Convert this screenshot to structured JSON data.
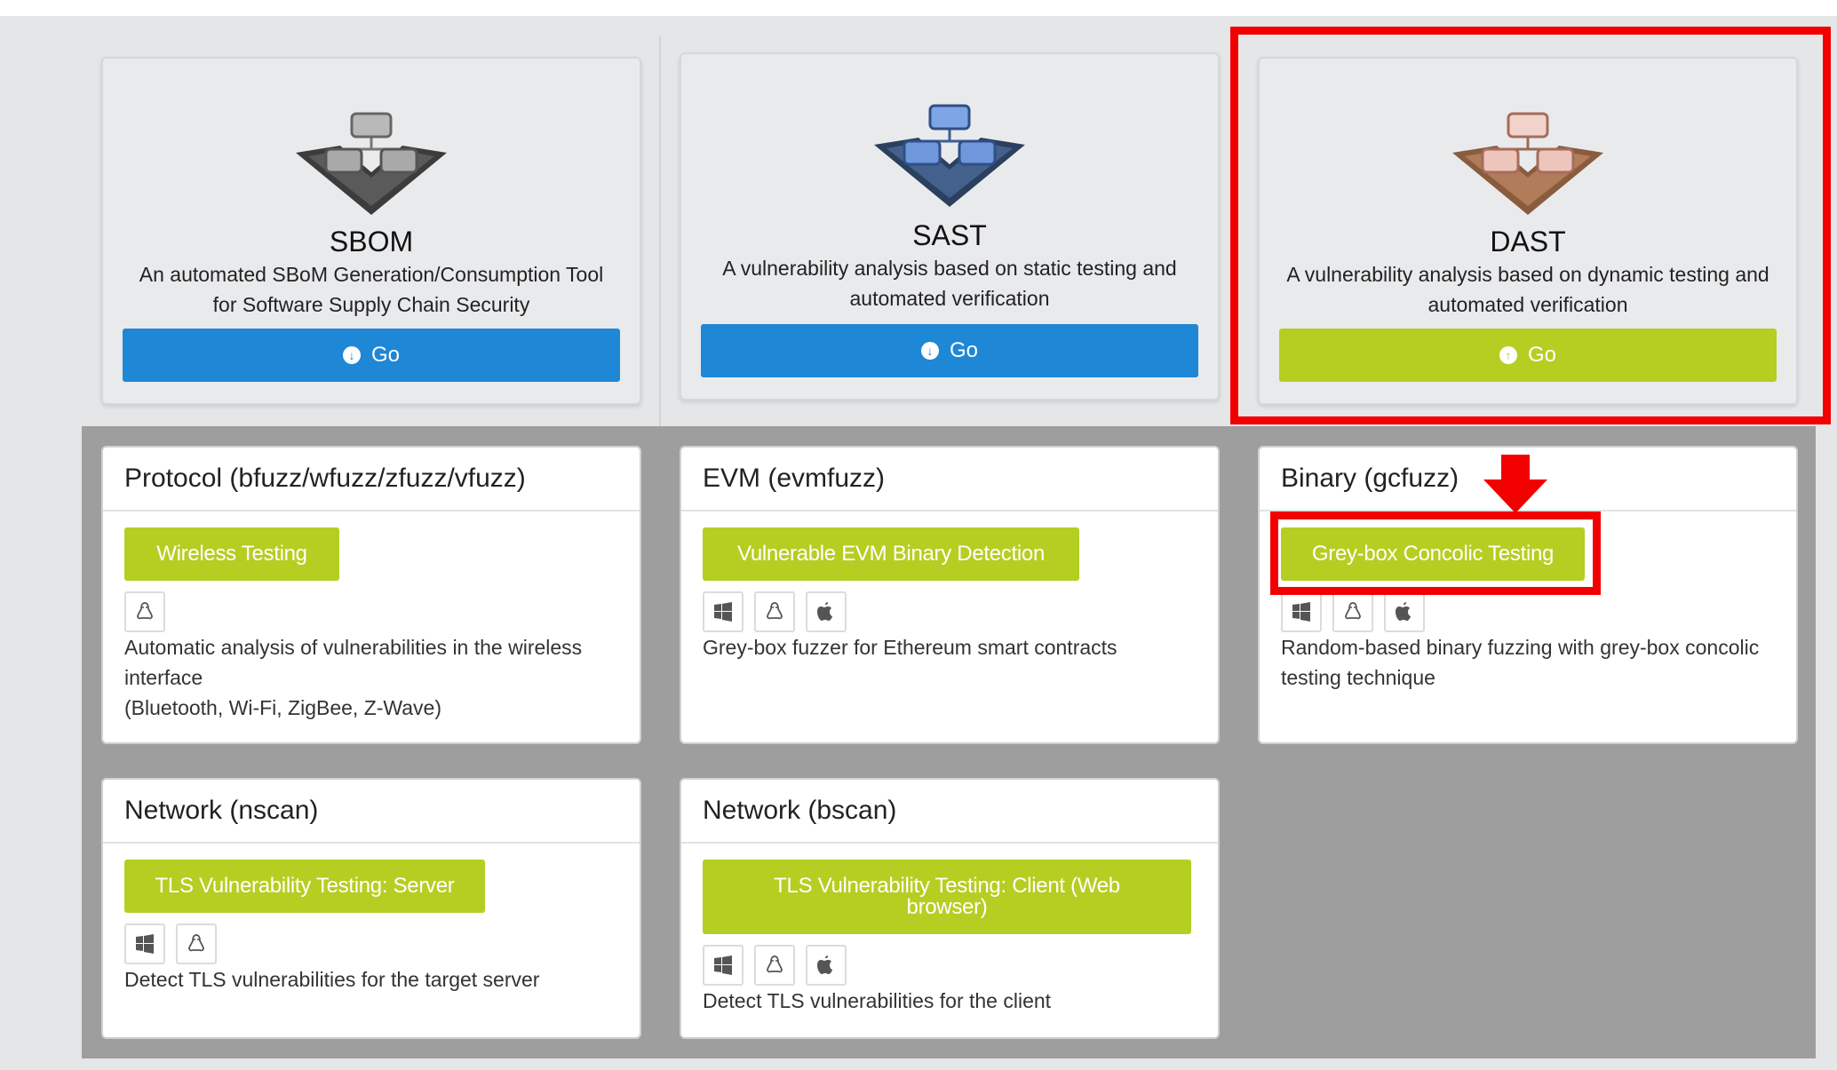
{
  "categories": [
    {
      "title": "SBOM",
      "desc_lines": [
        "An automated SBoM Generation/Consumption Tool",
        "for Software Supply Chain Security"
      ],
      "go_label": "Go",
      "icon": "download-circle-icon",
      "color": "#1e87d6"
    },
    {
      "title": "SAST",
      "desc_lines": [
        "A vulnerability analysis based on static testing and",
        "automated verification"
      ],
      "go_label": "Go",
      "icon": "download-circle-icon",
      "color": "#1e87d6"
    },
    {
      "title": "DAST",
      "desc_lines": [
        "A vulnerability analysis based on dynamic testing and",
        "automated verification"
      ],
      "go_label": "Go",
      "icon": "upload-circle-icon",
      "color": "#b5ce22"
    }
  ],
  "tools": [
    {
      "title": "Protocol (bfuzz/wfuzz/zfuzz/vfuzz)",
      "button": "Wireless Testing",
      "platforms": [
        "linux-icon"
      ],
      "desc_lines": [
        "Automatic analysis of vulnerabilities in the wireless",
        "interface",
        "(Bluetooth, Wi-Fi, ZigBee, Z-Wave)"
      ]
    },
    {
      "title": "EVM (evmfuzz)",
      "button": "Vulnerable EVM Binary Detection",
      "platforms": [
        "windows-icon",
        "linux-icon",
        "apple-icon"
      ],
      "desc_lines": [
        "Grey-box fuzzer for Ethereum smart contracts"
      ]
    },
    {
      "title": "Binary (gcfuzz)",
      "button": "Grey-box Concolic Testing",
      "platforms": [
        "windows-icon",
        "linux-icon",
        "apple-icon"
      ],
      "desc_lines": [
        "Random-based binary fuzzing with grey-box concolic",
        "testing technique"
      ]
    },
    {
      "title": "Network (nscan)",
      "button": "TLS Vulnerability Testing: Server",
      "platforms": [
        "windows-icon",
        "linux-icon"
      ],
      "desc_lines": [
        "Detect TLS vulnerabilities for the target server"
      ]
    },
    {
      "title": "Network (bscan)",
      "button_lines": [
        "TLS Vulnerability Testing: Client (Web",
        "browser)"
      ],
      "platforms": [
        "windows-icon",
        "linux-icon",
        "apple-icon"
      ],
      "desc_lines": [
        "Detect TLS vulnerabilities for the client"
      ]
    }
  ],
  "colors": {
    "accent_blue": "#1e87d6",
    "accent_green": "#b5ce22",
    "highlight_red": "#f20000"
  }
}
